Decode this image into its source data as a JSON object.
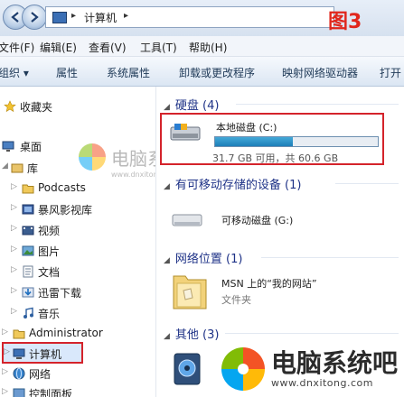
{
  "address": {
    "crumb": "计算机"
  },
  "figure_label": "图3",
  "menu": [
    "文件(F)",
    "编辑(E)",
    "查看(V)",
    "工具(T)",
    "帮助(H)"
  ],
  "toolbar": [
    "组织 ▾",
    "属性",
    "系统属性",
    "卸载或更改程序",
    "映射网络驱动器",
    "打开"
  ],
  "nav": {
    "favorites": "收藏夹",
    "desktop": "桌面",
    "library": "库",
    "podcasts": "Podcasts",
    "baofeng": "暴风影视库",
    "video": "视频",
    "pictures": "图片",
    "docs": "文档",
    "xunlei": "迅雷下载",
    "music": "音乐",
    "admin": "Administrator",
    "computer": "计算机",
    "network": "网络",
    "control": "控制面板"
  },
  "groups": {
    "hdd": "硬盘 (4)",
    "removable": "有可移动存储的设备 (1)",
    "netloc": "网络位置 (1)",
    "other": "其他 (3)"
  },
  "drive": {
    "name": "本地磁盘 (C:)",
    "capacity": "31.7 GB 可用，共 60.6 GB",
    "used_fraction": 0.48
  },
  "removable_name": "可移动磁盘 (G:)",
  "msn": {
    "name": "MSN 上的“我的网站”",
    "type": "文件夹"
  },
  "watermark": {
    "text_small": "电脑系统吧",
    "url_small": "www.dnxitong.com",
    "text_big": "电脑系统吧",
    "url_big": "www.dnxitong.com"
  },
  "colors": {
    "highlight_border": "#d4232b",
    "figure_label": "#e1261c",
    "group_title": "#1e3287"
  }
}
